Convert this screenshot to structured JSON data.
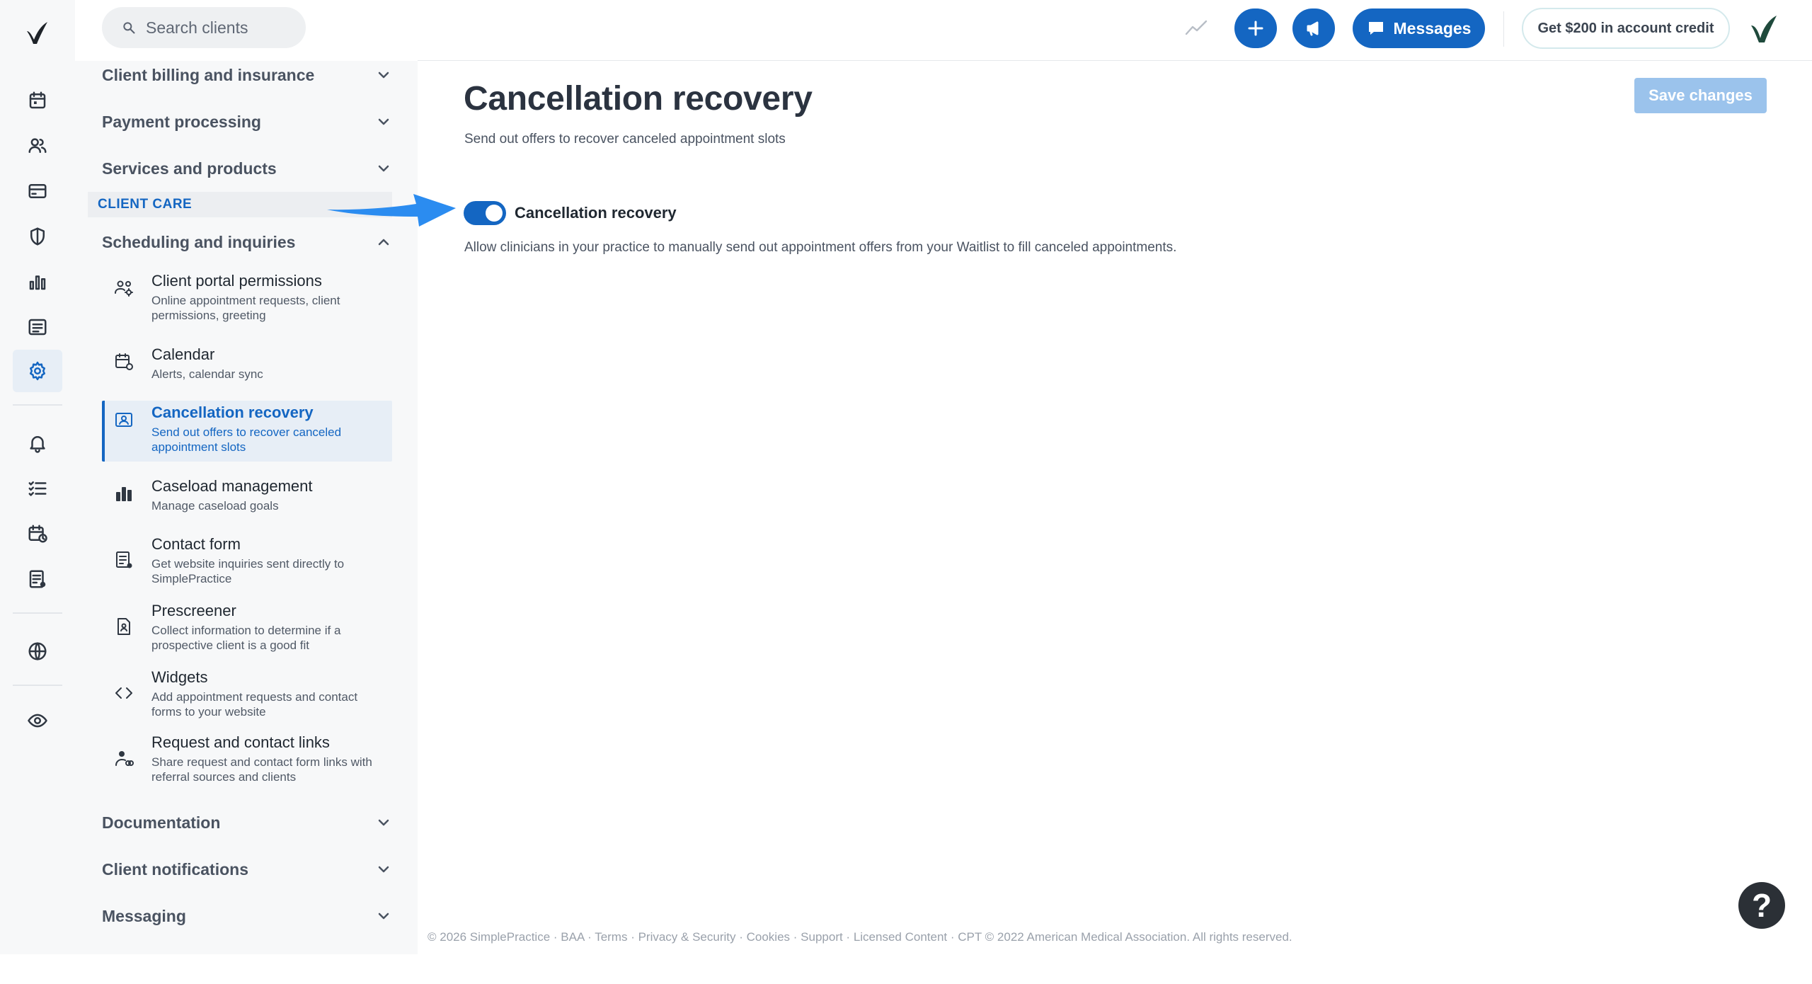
{
  "search": {
    "placeholder": "Search clients"
  },
  "topbar": {
    "messages_label": "Messages",
    "credit_label": "Get $200 in account credit"
  },
  "nav": {
    "sections_top": [
      {
        "label": "Client billing and insurance"
      },
      {
        "label": "Payment processing"
      },
      {
        "label": "Services and products"
      }
    ],
    "category": "CLIENT CARE",
    "open_section": {
      "label": "Scheduling and inquiries"
    },
    "items": [
      {
        "title": "Client portal permissions",
        "desc": "Online appointment requests, client permissions, greeting",
        "icon": "users-gear-icon"
      },
      {
        "title": "Calendar",
        "desc": "Alerts, calendar sync",
        "icon": "calendar-gear-icon"
      },
      {
        "title": "Cancellation recovery",
        "desc": "Send out offers to recover canceled appointment slots",
        "icon": "id-card-icon"
      },
      {
        "title": "Caseload management",
        "desc": "Manage caseload goals",
        "icon": "bar-chart-icon"
      },
      {
        "title": "Contact form",
        "desc": "Get website inquiries sent directly to SimplePractice",
        "icon": "form-icon"
      },
      {
        "title": "Prescreener",
        "desc": "Collect information to determine if a prospective client is a good fit",
        "icon": "document-person-icon"
      },
      {
        "title": "Widgets",
        "desc": "Add appointment requests and contact forms to your website",
        "icon": "code-icon"
      },
      {
        "title": "Request and contact links",
        "desc": "Share request and contact form links with referral sources and clients",
        "icon": "person-link-icon"
      }
    ],
    "sections_bottom": [
      {
        "label": "Documentation"
      },
      {
        "label": "Client notifications"
      },
      {
        "label": "Messaging"
      }
    ]
  },
  "main": {
    "title": "Cancellation recovery",
    "subtitle": "Send out offers to recover canceled appointment slots",
    "save_label": "Save changes",
    "toggle": {
      "label": "Cancellation recovery",
      "on": true,
      "description": "Allow clinicians in your practice to manually send out appointment offers from your Waitlist to fill canceled appointments."
    }
  },
  "footer": {
    "copyright": "© 2026 SimplePractice",
    "links": [
      "BAA",
      "Terms",
      "Privacy & Security",
      "Cookies",
      "Support",
      "Licensed Content"
    ],
    "cpt": "CPT © 2022 American Medical Association. All rights reserved."
  },
  "help": {
    "label": "?"
  },
  "colors": {
    "accent": "#1466c2",
    "annotation_arrow": "#2b8cf0"
  }
}
